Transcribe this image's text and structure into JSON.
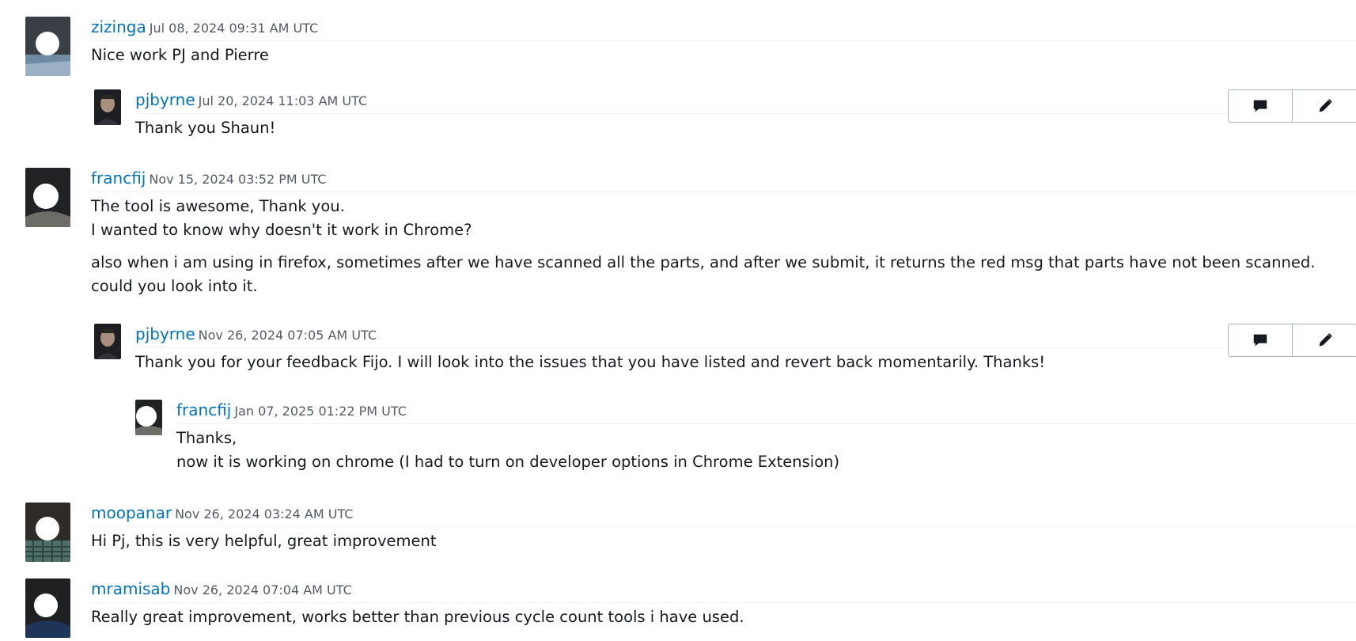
{
  "comments": [
    {
      "username": "zizinga",
      "timestamp": "Jul 08, 2024 09:31 AM UTC",
      "lines": [
        "Nice work PJ and Pierre"
      ]
    },
    {
      "username": "pjbyrne",
      "timestamp": "Jul 20, 2024 11:03 AM UTC",
      "lines": [
        "Thank you Shaun!"
      ]
    },
    {
      "username": "francfij",
      "timestamp": "Nov 15, 2024 03:52 PM UTC",
      "lines": [
        "The tool is awesome, Thank you.",
        "I wanted to know why doesn't it work in Chrome?",
        "also when i am using in firefox, sometimes after we have scanned all the parts, and after we submit, it returns the red msg that parts have not been scanned. could you look into it."
      ]
    },
    {
      "username": "pjbyrne",
      "timestamp": "Nov 26, 2024 07:05 AM UTC",
      "lines": [
        "Thank you for your feedback Fijo. I will look into the issues that you have listed and revert back momentarily. Thanks!"
      ]
    },
    {
      "username": "francfij",
      "timestamp": "Jan 07, 2025 01:22 PM UTC",
      "lines": [
        "Thanks,",
        "now it is working on chrome (I had to turn on developer options in Chrome Extension)"
      ]
    },
    {
      "username": "moopanar",
      "timestamp": "Nov 26, 2024 03:24 AM UTC",
      "lines": [
        "Hi Pj, this is very helpful, great improvement"
      ]
    },
    {
      "username": "mramisab",
      "timestamp": "Nov 26, 2024 07:04 AM UTC",
      "lines": [
        "Really great improvement, works better than previous cycle count tools i have used."
      ]
    }
  ],
  "icons": {
    "reply": "speech-bubble-icon",
    "edit": "pencil-icon"
  },
  "colors": {
    "username": "#0073bb",
    "timestamp": "#545b64",
    "text": "#16191f",
    "button_border": "#aab7b8"
  }
}
